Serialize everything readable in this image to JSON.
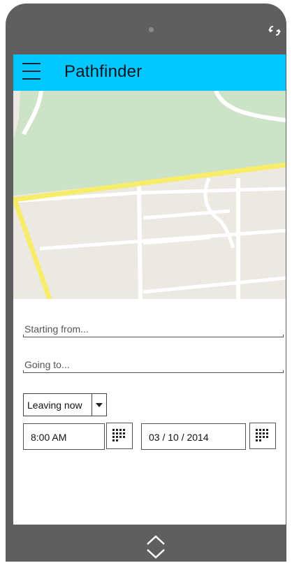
{
  "app": {
    "title": "Pathfinder"
  },
  "form": {
    "start_placeholder": "Starting from...",
    "destination_placeholder": "Going to...",
    "timing": {
      "selected": "Leaving now"
    },
    "time": "8:00 AM",
    "date": "03 / 10 / 2014"
  },
  "icons": {
    "menu": "hamburger-icon",
    "rotate": "rotate-icon",
    "time_picker": "grid-icon",
    "date_picker": "grid-icon",
    "nav": "up-down-chevron-icon"
  },
  "colors": {
    "appbar": "#00c8ff",
    "device_frame": "#5f5f5f",
    "map_park": "#cde3c7",
    "map_road_major": "#f7ed6a",
    "map_bg": "#ece9e3"
  }
}
